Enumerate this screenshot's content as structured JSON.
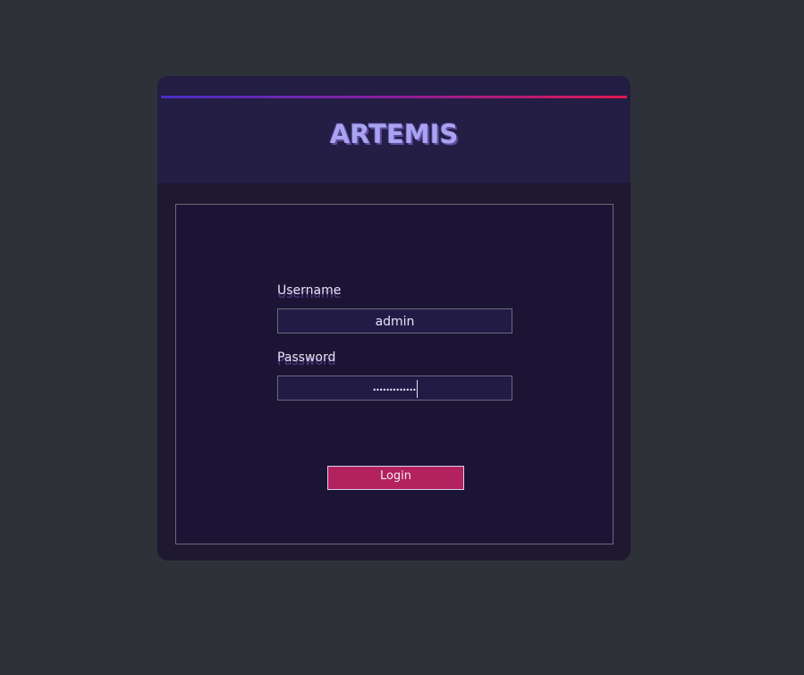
{
  "app": {
    "title": "ARTEMIS"
  },
  "form": {
    "username_label": "Username",
    "username_value": "admin",
    "password_label": "Password",
    "password_masked": "•••••••••••••",
    "login_label": "Login"
  },
  "colors": {
    "background": "#2f3139",
    "card": "#1e1830",
    "header": "#241d44",
    "accent_start": "#4a2fc7",
    "accent_end": "#e0184f",
    "button": "#b3215f"
  }
}
